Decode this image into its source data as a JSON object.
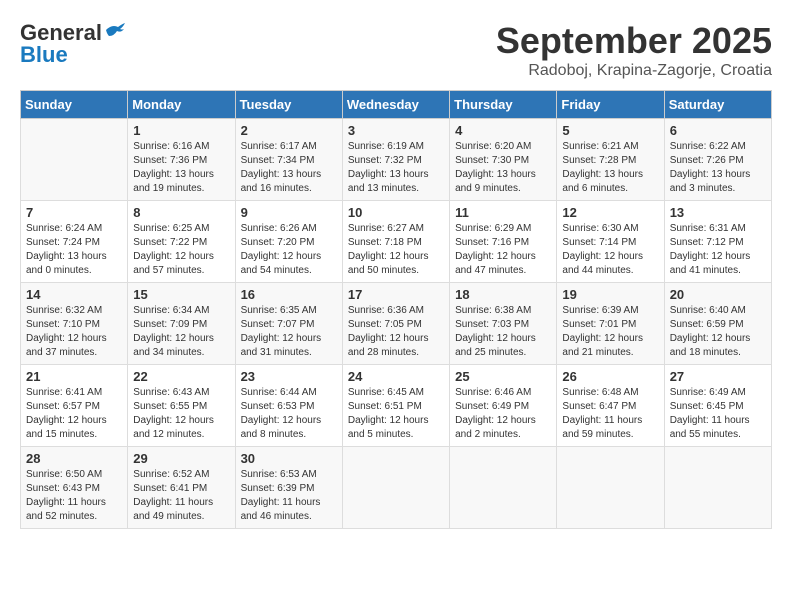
{
  "header": {
    "logo_general": "General",
    "logo_blue": "Blue",
    "month_title": "September 2025",
    "location": "Radoboj, Krapina-Zagorje, Croatia"
  },
  "weekdays": [
    "Sunday",
    "Monday",
    "Tuesday",
    "Wednesday",
    "Thursday",
    "Friday",
    "Saturday"
  ],
  "weeks": [
    [
      {
        "day": "",
        "info": ""
      },
      {
        "day": "1",
        "info": "Sunrise: 6:16 AM\nSunset: 7:36 PM\nDaylight: 13 hours\nand 19 minutes."
      },
      {
        "day": "2",
        "info": "Sunrise: 6:17 AM\nSunset: 7:34 PM\nDaylight: 13 hours\nand 16 minutes."
      },
      {
        "day": "3",
        "info": "Sunrise: 6:19 AM\nSunset: 7:32 PM\nDaylight: 13 hours\nand 13 minutes."
      },
      {
        "day": "4",
        "info": "Sunrise: 6:20 AM\nSunset: 7:30 PM\nDaylight: 13 hours\nand 9 minutes."
      },
      {
        "day": "5",
        "info": "Sunrise: 6:21 AM\nSunset: 7:28 PM\nDaylight: 13 hours\nand 6 minutes."
      },
      {
        "day": "6",
        "info": "Sunrise: 6:22 AM\nSunset: 7:26 PM\nDaylight: 13 hours\nand 3 minutes."
      }
    ],
    [
      {
        "day": "7",
        "info": "Sunrise: 6:24 AM\nSunset: 7:24 PM\nDaylight: 13 hours\nand 0 minutes."
      },
      {
        "day": "8",
        "info": "Sunrise: 6:25 AM\nSunset: 7:22 PM\nDaylight: 12 hours\nand 57 minutes."
      },
      {
        "day": "9",
        "info": "Sunrise: 6:26 AM\nSunset: 7:20 PM\nDaylight: 12 hours\nand 54 minutes."
      },
      {
        "day": "10",
        "info": "Sunrise: 6:27 AM\nSunset: 7:18 PM\nDaylight: 12 hours\nand 50 minutes."
      },
      {
        "day": "11",
        "info": "Sunrise: 6:29 AM\nSunset: 7:16 PM\nDaylight: 12 hours\nand 47 minutes."
      },
      {
        "day": "12",
        "info": "Sunrise: 6:30 AM\nSunset: 7:14 PM\nDaylight: 12 hours\nand 44 minutes."
      },
      {
        "day": "13",
        "info": "Sunrise: 6:31 AM\nSunset: 7:12 PM\nDaylight: 12 hours\nand 41 minutes."
      }
    ],
    [
      {
        "day": "14",
        "info": "Sunrise: 6:32 AM\nSunset: 7:10 PM\nDaylight: 12 hours\nand 37 minutes."
      },
      {
        "day": "15",
        "info": "Sunrise: 6:34 AM\nSunset: 7:09 PM\nDaylight: 12 hours\nand 34 minutes."
      },
      {
        "day": "16",
        "info": "Sunrise: 6:35 AM\nSunset: 7:07 PM\nDaylight: 12 hours\nand 31 minutes."
      },
      {
        "day": "17",
        "info": "Sunrise: 6:36 AM\nSunset: 7:05 PM\nDaylight: 12 hours\nand 28 minutes."
      },
      {
        "day": "18",
        "info": "Sunrise: 6:38 AM\nSunset: 7:03 PM\nDaylight: 12 hours\nand 25 minutes."
      },
      {
        "day": "19",
        "info": "Sunrise: 6:39 AM\nSunset: 7:01 PM\nDaylight: 12 hours\nand 21 minutes."
      },
      {
        "day": "20",
        "info": "Sunrise: 6:40 AM\nSunset: 6:59 PM\nDaylight: 12 hours\nand 18 minutes."
      }
    ],
    [
      {
        "day": "21",
        "info": "Sunrise: 6:41 AM\nSunset: 6:57 PM\nDaylight: 12 hours\nand 15 minutes."
      },
      {
        "day": "22",
        "info": "Sunrise: 6:43 AM\nSunset: 6:55 PM\nDaylight: 12 hours\nand 12 minutes."
      },
      {
        "day": "23",
        "info": "Sunrise: 6:44 AM\nSunset: 6:53 PM\nDaylight: 12 hours\nand 8 minutes."
      },
      {
        "day": "24",
        "info": "Sunrise: 6:45 AM\nSunset: 6:51 PM\nDaylight: 12 hours\nand 5 minutes."
      },
      {
        "day": "25",
        "info": "Sunrise: 6:46 AM\nSunset: 6:49 PM\nDaylight: 12 hours\nand 2 minutes."
      },
      {
        "day": "26",
        "info": "Sunrise: 6:48 AM\nSunset: 6:47 PM\nDaylight: 11 hours\nand 59 minutes."
      },
      {
        "day": "27",
        "info": "Sunrise: 6:49 AM\nSunset: 6:45 PM\nDaylight: 11 hours\nand 55 minutes."
      }
    ],
    [
      {
        "day": "28",
        "info": "Sunrise: 6:50 AM\nSunset: 6:43 PM\nDaylight: 11 hours\nand 52 minutes."
      },
      {
        "day": "29",
        "info": "Sunrise: 6:52 AM\nSunset: 6:41 PM\nDaylight: 11 hours\nand 49 minutes."
      },
      {
        "day": "30",
        "info": "Sunrise: 6:53 AM\nSunset: 6:39 PM\nDaylight: 11 hours\nand 46 minutes."
      },
      {
        "day": "",
        "info": ""
      },
      {
        "day": "",
        "info": ""
      },
      {
        "day": "",
        "info": ""
      },
      {
        "day": "",
        "info": ""
      }
    ]
  ]
}
